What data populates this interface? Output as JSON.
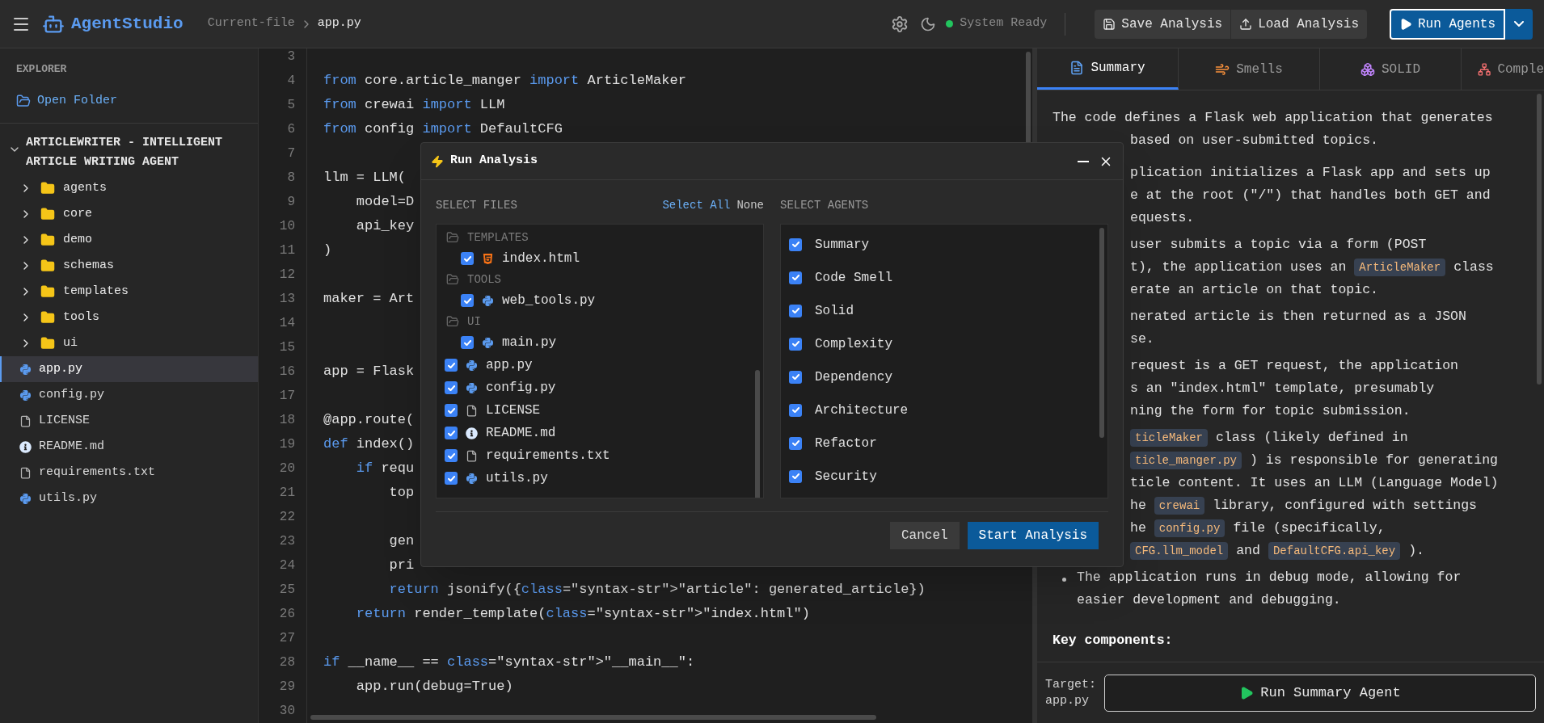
{
  "header": {
    "app_name": "AgentStudio",
    "breadcrumb": [
      "Current-file",
      "app.py"
    ],
    "status": "System Ready",
    "buttons": [
      "Save Analysis",
      "Load Analysis"
    ],
    "primary_button": "Run Agents"
  },
  "sidebar": {
    "title": "EXPLORER",
    "open_folder": "Open Folder",
    "project": {
      "name": "ARTICLEWRITER - INTELLIGENT ARTICLE WRITING AGENT",
      "expanded": true
    },
    "items": [
      {
        "kind": "folder",
        "name": "agents",
        "expanded": false,
        "selected": false
      },
      {
        "kind": "folder",
        "name": "core",
        "expanded": false,
        "selected": false
      },
      {
        "kind": "folder",
        "name": "demo",
        "expanded": false,
        "selected": false
      },
      {
        "kind": "folder",
        "name": "schemas",
        "expanded": false,
        "selected": false
      },
      {
        "kind": "folder",
        "name": "templates",
        "expanded": false,
        "selected": false
      },
      {
        "kind": "folder",
        "name": "tools",
        "expanded": false,
        "selected": false
      },
      {
        "kind": "folder",
        "name": "ui",
        "expanded": false,
        "selected": false
      },
      {
        "kind": "python",
        "name": "app.py",
        "selected": true
      },
      {
        "kind": "python",
        "name": "config.py",
        "selected": false
      },
      {
        "kind": "text",
        "name": "LICENSE",
        "selected": false
      },
      {
        "kind": "info",
        "name": "README.md",
        "selected": false
      },
      {
        "kind": "text",
        "name": "requirements.txt",
        "selected": false
      },
      {
        "kind": "python",
        "name": "utils.py",
        "selected": false
      }
    ]
  },
  "editor": {
    "lines": [
      {
        "number": "3"
      },
      {
        "number": "4",
        "tokens": [
          {
            "kind": "keyword",
            "text": "from"
          },
          {
            "kind": "plain",
            "text": " core.article_manger "
          },
          {
            "kind": "keyword",
            "text": "import"
          },
          {
            "kind": "plain",
            "text": " ArticleMaker"
          }
        ]
      },
      {
        "number": "5",
        "tokens": [
          {
            "kind": "keyword",
            "text": "from"
          },
          {
            "kind": "plain",
            "text": " crewai "
          },
          {
            "kind": "keyword",
            "text": "import"
          },
          {
            "kind": "plain",
            "text": " LLM"
          }
        ]
      },
      {
        "number": "6",
        "tokens": [
          {
            "kind": "keyword",
            "text": "from"
          },
          {
            "kind": "plain",
            "text": " config "
          },
          {
            "kind": "keyword",
            "text": "import"
          },
          {
            "kind": "plain",
            "text": " DefaultCFG"
          }
        ]
      },
      {
        "number": "7"
      },
      {
        "number": "8",
        "tokens": [
          {
            "kind": "plain",
            "text": "llm = LLM("
          }
        ]
      },
      {
        "number": "9",
        "tokens": [
          {
            "kind": "plain",
            "text": "    model=D"
          }
        ]
      },
      {
        "number": "10",
        "tokens": [
          {
            "kind": "plain",
            "text": "    api_key"
          }
        ]
      },
      {
        "number": "11",
        "tokens": [
          {
            "kind": "plain",
            "text": ")"
          }
        ]
      },
      {
        "number": "12"
      },
      {
        "number": "13",
        "tokens": [
          {
            "kind": "plain",
            "text": "maker = Art"
          }
        ]
      },
      {
        "number": "14"
      },
      {
        "number": "15"
      },
      {
        "number": "16",
        "tokens": [
          {
            "kind": "plain",
            "text": "app = Flask"
          }
        ]
      },
      {
        "number": "17"
      },
      {
        "number": "18",
        "tokens": [
          {
            "kind": "plain",
            "text": "@app.route("
          }
        ]
      },
      {
        "number": "19",
        "tokens": [
          {
            "kind": "keyword",
            "text": "def"
          },
          {
            "kind": "plain",
            "text": " index()"
          }
        ]
      },
      {
        "number": "20",
        "tokens": [
          {
            "kind": "keyword",
            "text": "    if"
          },
          {
            "kind": "plain",
            "text": " requ"
          }
        ]
      },
      {
        "number": "21",
        "tokens": [
          {
            "kind": "plain",
            "text": "        top"
          }
        ]
      },
      {
        "number": "22"
      },
      {
        "number": "23",
        "tokens": [
          {
            "kind": "plain",
            "text": "        gen"
          }
        ]
      },
      {
        "number": "24",
        "tokens": [
          {
            "kind": "plain",
            "text": "        pri"
          }
        ]
      },
      {
        "number": "25",
        "tokens": [
          {
            "kind": "keyword",
            "text": "        return"
          },
          {
            "kind": "plain",
            "text": " jsonify({"
          },
          {
            "kind": "keyword",
            "text": "class"
          },
          {
            "kind": "plain",
            "text": "=\"syntax-str\">\"article\": generated_article})"
          }
        ]
      },
      {
        "number": "26",
        "tokens": [
          {
            "kind": "keyword",
            "text": "    return"
          },
          {
            "kind": "plain",
            "text": " render_template("
          },
          {
            "kind": "keyword",
            "text": "class"
          },
          {
            "kind": "plain",
            "text": "=\"syntax-str\">\"index.html\")"
          }
        ]
      },
      {
        "number": "27"
      },
      {
        "number": "28",
        "tokens": [
          {
            "kind": "keyword",
            "text": "if"
          },
          {
            "kind": "plain",
            "text": " __name__ == "
          },
          {
            "kind": "keyword",
            "text": "class"
          },
          {
            "kind": "plain",
            "text": "=\"syntax-str\">\"__main__\":"
          }
        ]
      },
      {
        "number": "29",
        "tokens": [
          {
            "kind": "plain",
            "text": "    app.run(debug=True)"
          }
        ]
      },
      {
        "number": "30"
      }
    ]
  },
  "dialog": {
    "title": "Run Analysis",
    "files_label": "SELECT FILES",
    "select_all": "Select All",
    "select_none": "None",
    "agents_label": "SELECT AGENTS",
    "files": [
      {
        "kind": "group",
        "name": "TEMPLATES",
        "children": [
          {
            "kind": "html",
            "name": "index.html",
            "checked": true
          }
        ]
      },
      {
        "kind": "group",
        "name": "TOOLS",
        "children": [
          {
            "kind": "python",
            "name": "web_tools.py",
            "checked": true
          }
        ]
      },
      {
        "kind": "group",
        "name": "UI",
        "children": [
          {
            "kind": "python",
            "name": "main.py",
            "checked": true
          }
        ]
      },
      {
        "kind": "python",
        "name": "app.py",
        "checked": true
      },
      {
        "kind": "python",
        "name": "config.py",
        "checked": true
      },
      {
        "kind": "text",
        "name": "LICENSE",
        "checked": true
      },
      {
        "kind": "info",
        "name": "README.md",
        "checked": true
      },
      {
        "kind": "text",
        "name": "requirements.txt",
        "checked": true
      },
      {
        "kind": "python",
        "name": "utils.py",
        "checked": true
      }
    ],
    "agents": [
      {
        "name": "Summary",
        "checked": true
      },
      {
        "name": "Code Smell",
        "checked": true
      },
      {
        "name": "Solid",
        "checked": true
      },
      {
        "name": "Complexity",
        "checked": true
      },
      {
        "name": "Dependency",
        "checked": true
      },
      {
        "name": "Architecture",
        "checked": true
      },
      {
        "name": "Refactor",
        "checked": true
      },
      {
        "name": "Security",
        "checked": true
      }
    ],
    "cancel": "Cancel",
    "start": "Start Analysis"
  },
  "panel": {
    "tabs": [
      {
        "label": "Summary",
        "selected": true
      },
      {
        "label": "Smells",
        "selected": false
      },
      {
        "label": "SOLID",
        "selected": false
      },
      {
        "label": "Comple",
        "selected": false
      }
    ],
    "summary": {
      "intro": [
        {
          "clipped": false,
          "segments": [
            {
              "kind": "text",
              "text": "The code defines a Flask web application that generates"
            }
          ]
        },
        {
          "clipped": true,
          "segments": [
            {
              "kind": "text",
              "text": "based on user-submitted topics."
            }
          ]
        }
      ],
      "items": [
        {
          "lines": [
            {
              "clipped": true,
              "segments": [
                {
                  "kind": "text",
                  "text": "plication initializes a Flask app and sets up"
                }
              ]
            },
            {
              "clipped": true,
              "segments": [
                {
                  "kind": "text",
                  "text": "e at the root (\"/\") that handles both GET and"
                }
              ]
            },
            {
              "clipped": true,
              "segments": [
                {
                  "kind": "text",
                  "text": "equests."
                }
              ]
            }
          ]
        },
        {
          "lines": [
            {
              "clipped": true,
              "segments": [
                {
                  "kind": "text",
                  "text": "user submits a topic via a form (POST"
                }
              ]
            },
            {
              "clipped": true,
              "segments": [
                {
                  "kind": "text",
                  "text": "t), the application uses an"
                },
                {
                  "kind": "code",
                  "text": "ArticleMaker"
                },
                {
                  "kind": "text",
                  "text": "class"
                }
              ]
            },
            {
              "clipped": true,
              "segments": [
                {
                  "kind": "text",
                  "text": "erate an article on that topic."
                }
              ]
            }
          ]
        },
        {
          "lines": [
            {
              "clipped": true,
              "segments": [
                {
                  "kind": "text",
                  "text": "nerated article is then returned as a JSON"
                }
              ]
            },
            {
              "clipped": true,
              "segments": [
                {
                  "kind": "text",
                  "text": "se."
                }
              ]
            }
          ]
        },
        {
          "lines": [
            {
              "clipped": true,
              "segments": [
                {
                  "kind": "text",
                  "text": "request is a GET request, the application"
                }
              ]
            },
            {
              "clipped": true,
              "segments": [
                {
                  "kind": "text",
                  "text": "s an \"index.html\" template, presumably"
                }
              ]
            },
            {
              "clipped": true,
              "segments": [
                {
                  "kind": "text",
                  "text": "ning the form for topic submission."
                }
              ]
            }
          ]
        },
        {
          "lines": [
            {
              "clipped": true,
              "segments": [
                {
                  "kind": "code",
                  "text": "ticleMaker"
                },
                {
                  "kind": "text",
                  "text": "class (likely defined in"
                }
              ]
            },
            {
              "clipped": true,
              "segments": [
                {
                  "kind": "code",
                  "text": "ticle_manger.py"
                },
                {
                  "kind": "text",
                  "text": ") is responsible for generating"
                }
              ]
            },
            {
              "clipped": true,
              "segments": [
                {
                  "kind": "text",
                  "text": "ticle content. It uses an LLM (Language Model)"
                }
              ]
            },
            {
              "clipped": true,
              "segments": [
                {
                  "kind": "text",
                  "text": "he"
                },
                {
                  "kind": "code",
                  "text": "crewai"
                },
                {
                  "kind": "text",
                  "text": "library, configured with settings"
                }
              ]
            },
            {
              "clipped": true,
              "segments": [
                {
                  "kind": "text",
                  "text": "he"
                },
                {
                  "kind": "code",
                  "text": "config.py"
                },
                {
                  "kind": "text",
                  "text": "file (specifically,"
                }
              ]
            },
            {
              "clipped": true,
              "segments": [
                {
                  "kind": "code",
                  "text": "CFG.llm_model"
                },
                {
                  "kind": "text",
                  "text": "and"
                },
                {
                  "kind": "code",
                  "text": "DefaultCFG.api_key"
                },
                {
                  "kind": "text",
                  "text": ")."
                }
              ]
            }
          ]
        },
        {
          "lines": [
            {
              "clipped": false,
              "segments": [
                {
                  "kind": "text",
                  "text": "The application runs in debug mode, allowing for"
                }
              ]
            },
            {
              "clipped": false,
              "segments": [
                {
                  "kind": "text",
                  "text": "easier development and debugging."
                }
              ]
            }
          ]
        }
      ],
      "heading": "Key components:"
    },
    "target_label": "Target:",
    "target_file": "app.py",
    "run_button": "Run Summary Agent"
  }
}
